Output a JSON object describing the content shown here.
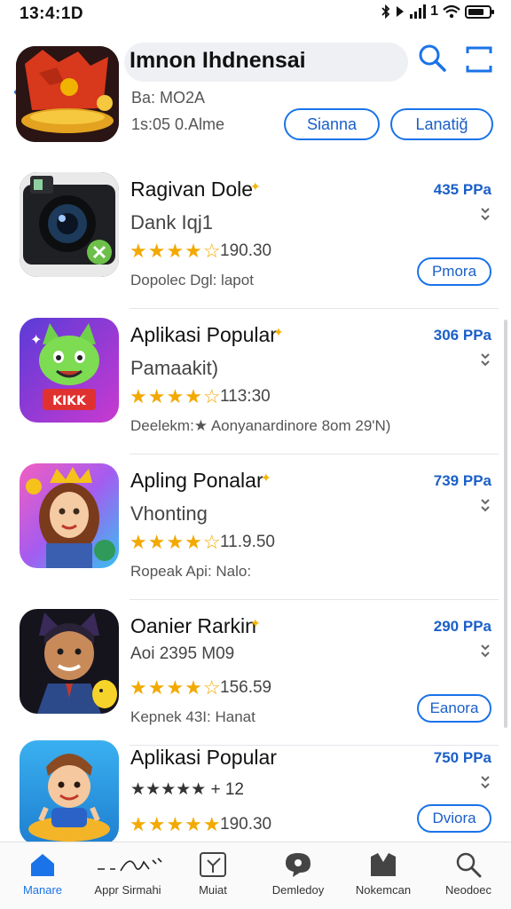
{
  "status_bar": {
    "time": "13:4:1D",
    "carrier_text": "1",
    "icons": [
      "bluetooth-icon",
      "nfc-icon",
      "signal-icon",
      "wifi-icon",
      "battery-icon"
    ]
  },
  "header": {
    "search_text": "Imnon Ihdnensai",
    "meta_line_1": "Ba: MO2A",
    "meta_line_2": "1s:05 0.Alme",
    "button_1": "Sianna",
    "button_2": "Lanatiğ"
  },
  "apps": [
    {
      "name": "Ragivan Dole",
      "subtitle": "Dank Iqj1",
      "stars": "★★★★☆",
      "rating": "190.30",
      "desc": "Dopolec Dgl:  lapot",
      "price": "435 PPa",
      "button": "Pmora",
      "icon": "camera-app-icon"
    },
    {
      "name": "Aplikasi Popular",
      "subtitle": "Pamaakit)",
      "stars": "★★★★☆",
      "rating": "113:30",
      "desc": "Deelekm:★ Aonyanardinore 8om 29'N)",
      "price": "306 PPa",
      "button": "",
      "icon": "cartoon-cat-app-icon"
    },
    {
      "name": "Apling Ponalar",
      "subtitle": "Vhonting",
      "stars": "★★★★☆",
      "rating": "11.9.50",
      "desc": "Ropeak Api: Nalo:",
      "price": "739 PPa",
      "button": "",
      "icon": "princess-app-icon"
    },
    {
      "name": "Oanier Rarkin",
      "subtitle": "Aoi 2395 M09",
      "stars": "★★★★☆",
      "rating": "156.59",
      "desc": "Kepnek 43I: Hanat",
      "price": "290 PPa",
      "button": "Eanora",
      "icon": "character-app-icon"
    },
    {
      "name": "Aplikasi Popular",
      "subtitle": "★★★★★ + 12",
      "stars": "★★★★★",
      "rating": "190.30",
      "desc": "",
      "price": "750 PPa",
      "button": "Dviora",
      "icon": "boy-app-icon"
    }
  ],
  "tabs": [
    {
      "label": "Manare",
      "icon": "home-icon",
      "active": true
    },
    {
      "label": "Appr Sirmahi",
      "icon": "scribble-icon",
      "active": false
    },
    {
      "label": "Muiat",
      "icon": "calendar-icon",
      "active": false
    },
    {
      "label": "Demledoy",
      "icon": "chat-icon",
      "active": false
    },
    {
      "label": "Nokemcan",
      "icon": "gallery-icon",
      "active": false
    },
    {
      "label": "Neodoec",
      "icon": "search-icon",
      "active": false
    }
  ],
  "colors": {
    "accent": "#1a73e8",
    "star": "#f2a900",
    "price": "#1a5fc8"
  }
}
